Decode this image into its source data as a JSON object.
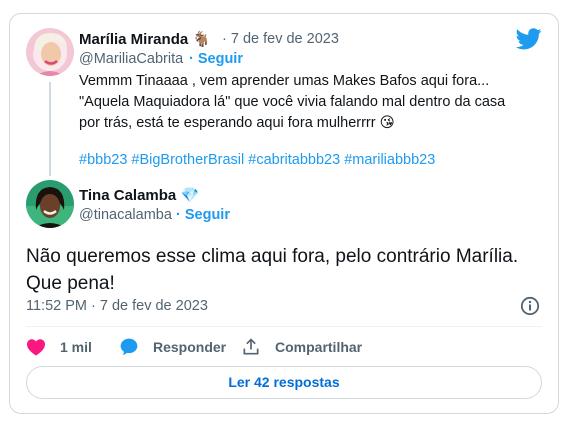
{
  "quoted_tweet": {
    "author_name": "Marília Miranda",
    "name_emoji": "🐐",
    "date": "· 7 de fev de 2023",
    "handle": "@MariliaCabrita",
    "follow_label": "· Seguir",
    "text_lines": [
      "Vemmm Tinaaaa , vem aprender umas Makes Bafos aqui fora...",
      "\"Aquela Maquiadora lá\" que você vivia falando mal dentro da casa",
      "por trás, está te esperando aqui fora mulherrrr"
    ],
    "text_emoji": "😘",
    "hashtags": "#bbb23 #BigBrotherBrasil #cabritabbb23 #mariliabbb23"
  },
  "main_tweet": {
    "author_name": "Tina Calamba",
    "name_emoji": "💎",
    "handle": "@tinacalamba",
    "follow_label": "· Seguir",
    "text_line1": "Não queremos esse clima aqui fora, pelo contrário Marília.",
    "text_line2": "Que pena!",
    "timestamp": "11:52 PM · 7 de fev de 2023"
  },
  "actions": {
    "likes": "1 mil",
    "reply_label": "Responder",
    "share_label": "Compartilhar"
  },
  "read_replies_label": "Ler 42 respostas",
  "icons": {
    "brand": "twitter-bird-icon",
    "info": "info-icon",
    "like": "heart-icon",
    "reply": "speech-bubble-icon",
    "share": "upload-icon"
  },
  "colors": {
    "accent": "#1d9bf0",
    "like": "#f91880",
    "muted": "#536471",
    "border": "#cfd9de"
  }
}
